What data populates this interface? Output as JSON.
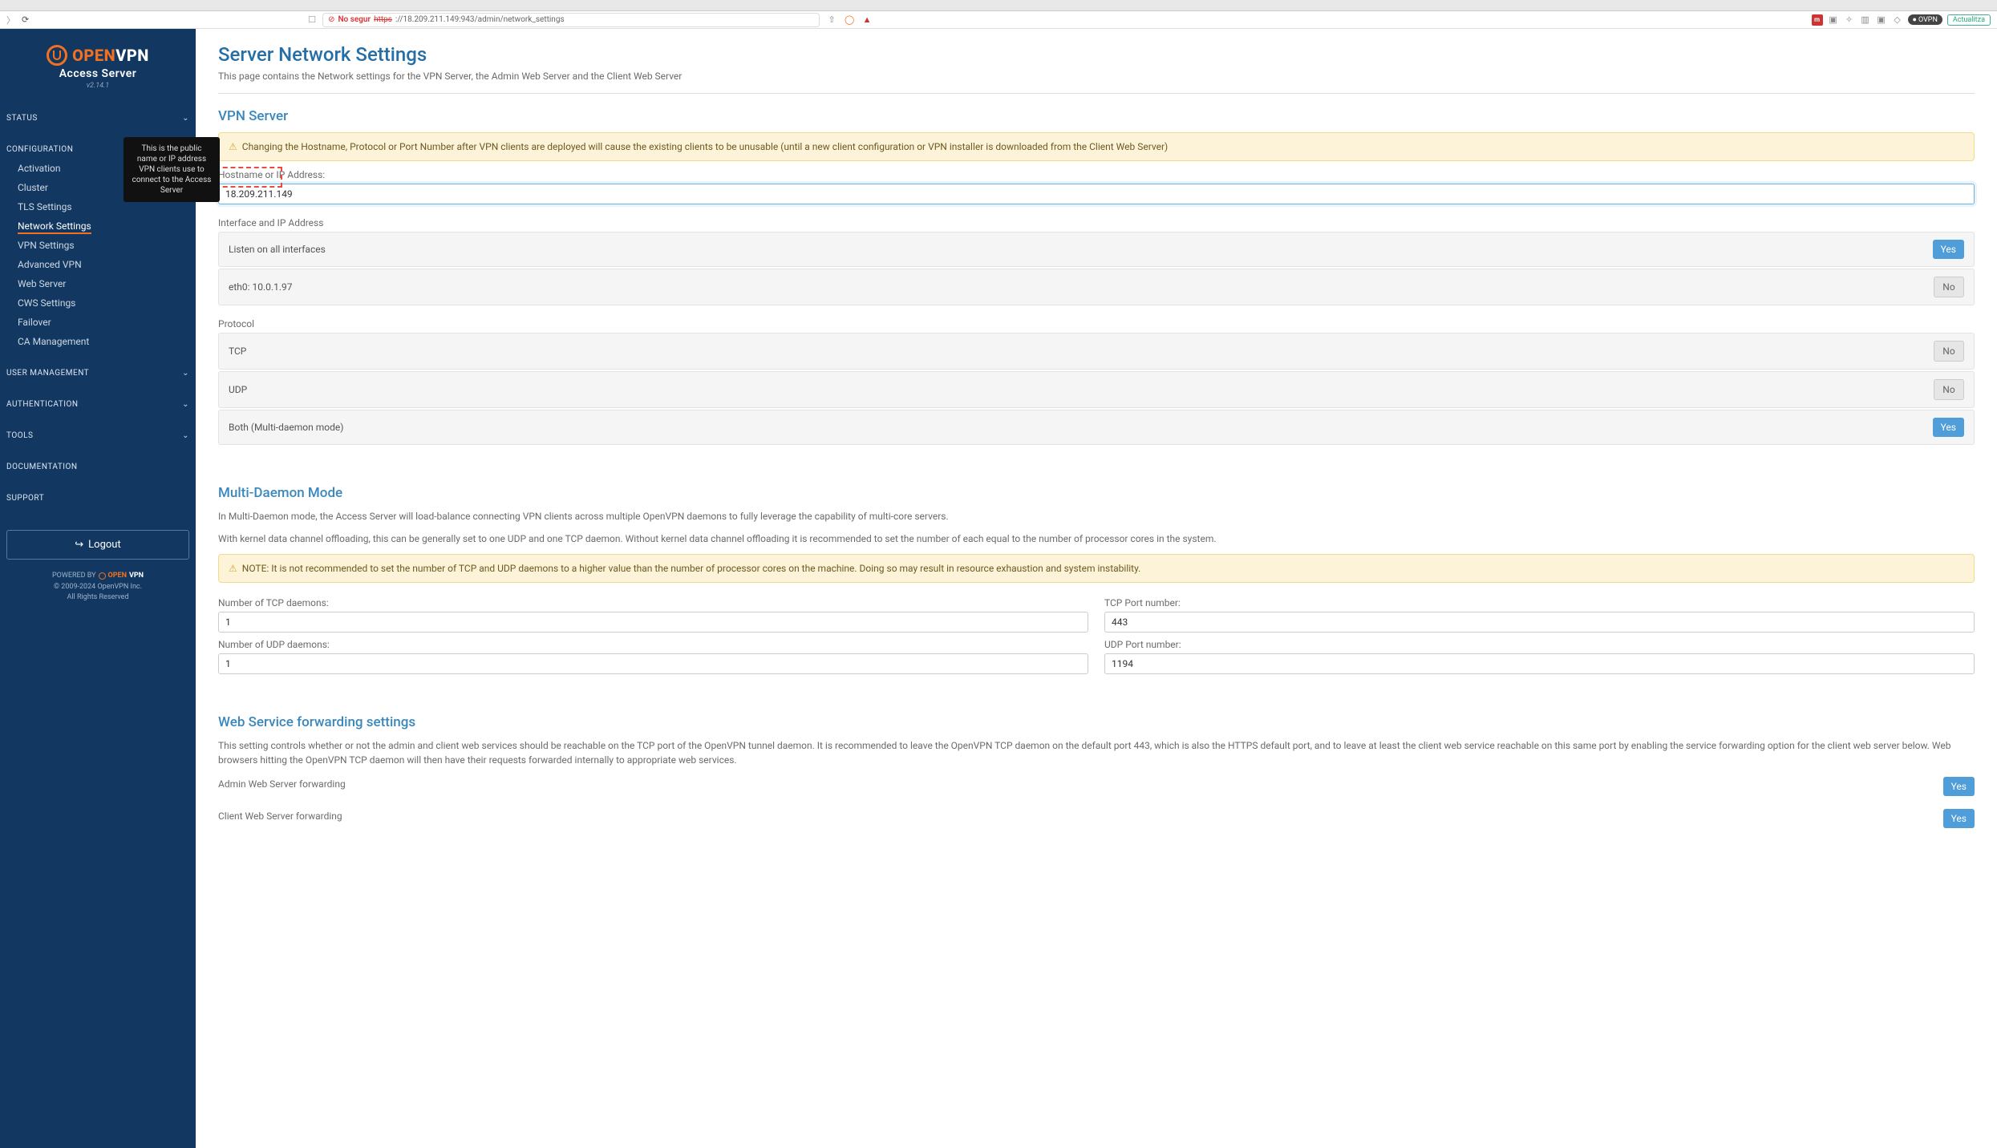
{
  "browser": {
    "not_secure": "No segur",
    "url_https": "https",
    "url_rest": "://18.209.211.149:943/admin/network_settings",
    "ovpn_badge": "OVPN",
    "update_btn": "Actualitza"
  },
  "logo": {
    "open": "OPEN",
    "vpn": "VPN",
    "sub": "Access Server",
    "version": "v2.14.1"
  },
  "sidebar": {
    "status": "STATUS",
    "configuration": "CONFIGURATION",
    "config_items": [
      {
        "label": "Activation"
      },
      {
        "label": "Cluster"
      },
      {
        "label": "TLS Settings"
      },
      {
        "label": "Network Settings"
      },
      {
        "label": "VPN Settings"
      },
      {
        "label": "Advanced VPN"
      },
      {
        "label": "Web Server"
      },
      {
        "label": "CWS Settings"
      },
      {
        "label": "Failover"
      },
      {
        "label": "CA Management"
      }
    ],
    "user_mgmt": "USER  MANAGEMENT",
    "auth": "AUTHENTICATION",
    "tools": "TOOLS",
    "docs": "DOCUMENTATION",
    "support": "SUPPORT",
    "logout": "Logout",
    "powered_by": "POWERED BY",
    "pb_open": "OPEN",
    "pb_vpn": "VPN",
    "copyright": "© 2009-2024 OpenVPN Inc.",
    "rights": "All Rights Reserved"
  },
  "tooltip": "This is the public name or IP address VPN clients use to connect to the Access Server",
  "page": {
    "title": "Server Network Settings",
    "subtitle": "This page contains the Network settings for the VPN Server, the Admin Web Server and the Client Web Server"
  },
  "vpn": {
    "heading": "VPN Server",
    "warning": "Changing the Hostname, Protocol or Port Number after VPN clients are deployed will cause the existing clients to be unusable (until a new client configuration or VPN installer is downloaded from the Client Web Server)",
    "hostname_label": "Hostname or IP Address:",
    "hostname_value": "18.209.211.149",
    "interface_label": "Interface and IP Address",
    "opts": [
      {
        "label": "Listen on all interfaces",
        "val": "Yes"
      },
      {
        "label": "eth0: 10.0.1.97",
        "val": "No"
      }
    ],
    "protocol_label": "Protocol",
    "protos": [
      {
        "label": "TCP",
        "val": "No"
      },
      {
        "label": "UDP",
        "val": "No"
      },
      {
        "label": "Both (Multi-daemon mode)",
        "val": "Yes"
      }
    ]
  },
  "multi": {
    "heading": "Multi-Daemon Mode",
    "desc1": "In Multi-Daemon mode, the Access Server will load-balance connecting VPN clients across multiple OpenVPN daemons to fully leverage the capability of multi-core servers.",
    "desc2": "With kernel data channel offloading, this can be generally set to one UDP and one TCP daemon. Without kernel data channel offloading it is recommended to set the number of each equal to the number of processor cores in the system.",
    "note": "NOTE: It is not recommended to set the number of TCP and UDP daemons to a higher value than the number of processor cores on the machine. Doing so may result in resource exhaustion and system instability.",
    "tcp_daemons_label": "Number of TCP daemons:",
    "tcp_daemons_val": "1",
    "tcp_port_label": "TCP Port number:",
    "tcp_port_val": "443",
    "udp_daemons_label": "Number of UDP daemons:",
    "udp_daemons_val": "1",
    "udp_port_label": "UDP Port number:",
    "udp_port_val": "1194"
  },
  "web": {
    "heading": "Web Service forwarding settings",
    "desc": "This setting controls whether or not the admin and client web services should be reachable on the TCP port of the OpenVPN tunnel daemon. It is recommended to leave the OpenVPN TCP daemon on the default port 443, which is also the HTTPS default port, and to leave at least the client web service reachable on this same port by enabling the service forwarding option for the client web server below. Web browsers hitting the OpenVPN TCP daemon will then have their requests forwarded internally to appropriate web services.",
    "admin_label": "Admin Web Server forwarding",
    "admin_val": "Yes",
    "client_label": "Client Web Server forwarding",
    "client_val": "Yes"
  }
}
